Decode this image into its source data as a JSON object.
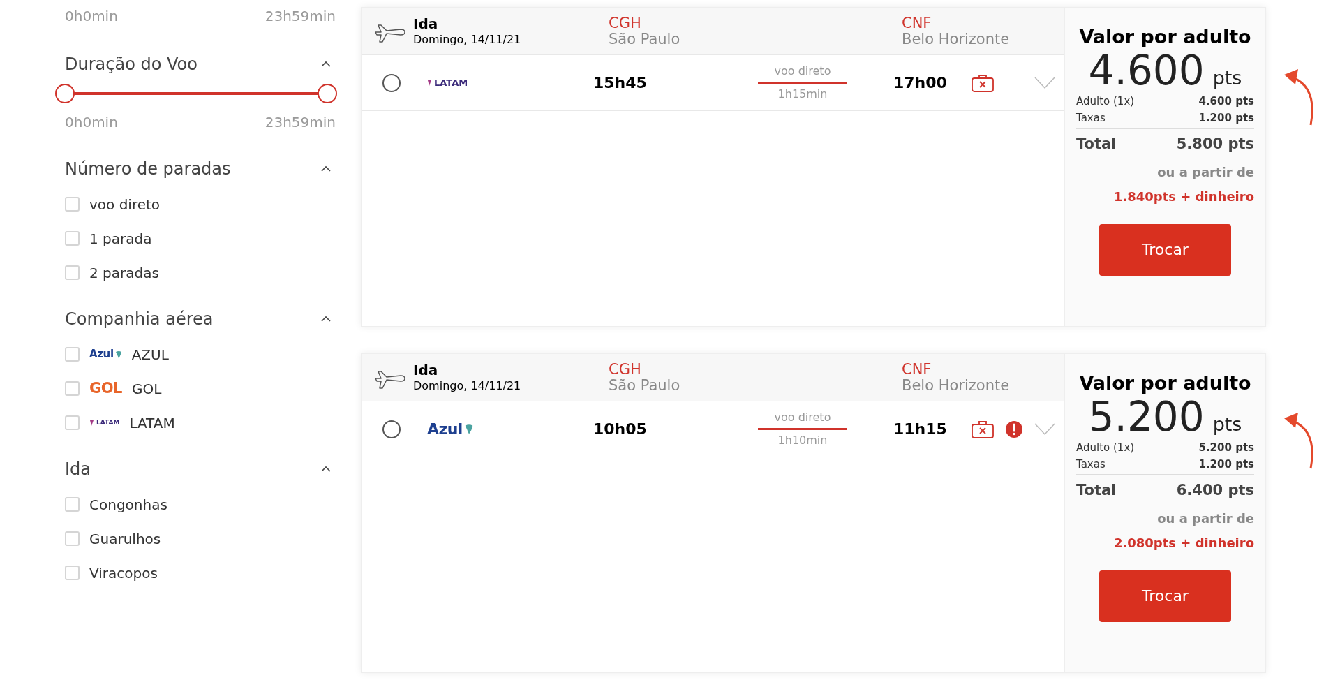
{
  "sidebar": {
    "top_range": {
      "min_label": "0h0min",
      "max_label": "23h59min"
    },
    "duration": {
      "title": "Duração do Voo",
      "expanded": true,
      "thumbs": [
        {
          "level": 0
        },
        {
          "level": 1
        }
      ],
      "min_label": "0h0min",
      "max_label": "23h59min"
    },
    "filters": [
      {
        "title": "Número de paradas",
        "expanded": true,
        "options": [
          {
            "label": "voo direto",
            "checked": false
          },
          {
            "label": "1 parada",
            "checked": false
          },
          {
            "label": "2 paradas",
            "checked": false
          }
        ]
      },
      {
        "title": "Companhia aérea",
        "expanded": true,
        "options": [
          {
            "label": "AZUL",
            "logo": "Azul",
            "kind": "azul",
            "checked": false
          },
          {
            "label": "GOL",
            "logo": "GOL",
            "kind": "gol",
            "checked": false
          },
          {
            "label": "LATAM",
            "logo": "LATAM",
            "kind": "latam",
            "checked": false
          }
        ]
      },
      {
        "title": "Ida",
        "expanded": true,
        "options": [
          {
            "label": "Congonhas",
            "checked": false
          },
          {
            "label": "Guarulhos",
            "checked": false
          },
          {
            "label": "Viracopos",
            "checked": false
          }
        ]
      }
    ]
  },
  "flights": [
    {
      "direction": "Ida",
      "date": "Domingo, 14/11/21",
      "origin_code": "CGH",
      "origin_city": "São Paulo",
      "dest_code": "CNF",
      "dest_city": "Belo Horizonte",
      "selected": false,
      "logo": "LATAM",
      "kind": "latam",
      "departure": "15h45",
      "stops": "voo direto",
      "duration": "1h15min",
      "arrival": "17h00",
      "alert": false,
      "expanded": false,
      "price": {
        "title": "Valor por adulto",
        "amount": "4.600",
        "unit": "pts",
        "lines": [
          {
            "label": "Adulto (1x)",
            "value": "4.600 pts"
          },
          {
            "label": "Taxas",
            "value": "1.200 pts"
          }
        ],
        "total_label": "Total",
        "total": "5.800 pts",
        "alt_label": "ou a partir de",
        "alt_value": "1.840pts + dinheiro",
        "button": "Trocar"
      }
    },
    {
      "direction": "Ida",
      "date": "Domingo, 14/11/21",
      "origin_code": "CGH",
      "origin_city": "São Paulo",
      "dest_code": "CNF",
      "dest_city": "Belo Horizonte",
      "selected": false,
      "logo": "Azul",
      "kind": "azul",
      "departure": "10h05",
      "stops": "voo direto",
      "duration": "1h10min",
      "arrival": "11h15",
      "alert": true,
      "expanded": false,
      "price": {
        "title": "Valor por adulto",
        "amount": "5.200",
        "unit": "pts",
        "lines": [
          {
            "label": "Adulto (1x)",
            "value": "5.200 pts"
          },
          {
            "label": "Taxas",
            "value": "1.200 pts"
          }
        ],
        "total_label": "Total",
        "total": "6.400 pts",
        "alt_label": "ou a partir de",
        "alt_value": "2.080pts + dinheiro",
        "button": "Trocar"
      }
    }
  ]
}
